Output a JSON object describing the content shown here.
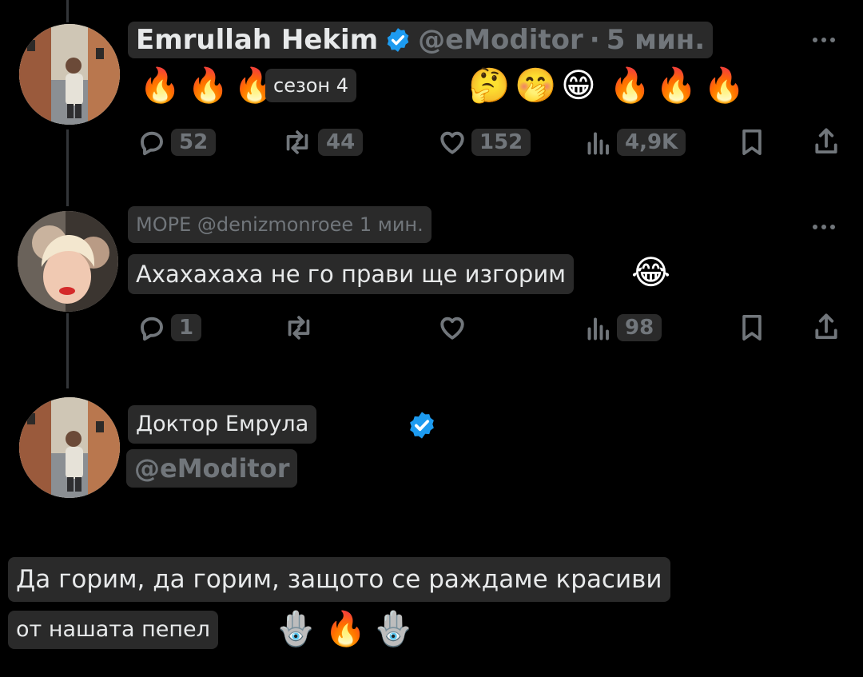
{
  "post": {
    "display_name": "Emrullah Hekim",
    "handle": "@eModitor",
    "separator": "·",
    "time": "5 мин.",
    "body_label": "сезон 4",
    "emoji_left": [
      "🔥",
      "🔥",
      "🔥"
    ],
    "emoji_right": [
      "🤔",
      "🤭",
      "😁",
      "🔥",
      "🔥",
      "🔥"
    ],
    "stats": {
      "replies": "52",
      "reposts": "44",
      "likes": "152",
      "views": "4,9K"
    }
  },
  "reply": {
    "display_name": "МОРЕ",
    "handle": "@denizmonroee",
    "time": "1 мин.",
    "text": "Ахахахаха не го прави ще изгорим",
    "emoji": "😂",
    "stats": {
      "replies": "1",
      "views": "98"
    }
  },
  "profile": {
    "display_name": "Доктор Емрула",
    "handle": "@eModitor"
  },
  "caption": {
    "line1": "Да горим, да горим, защото се раждаме красиви",
    "line2": "от нашата пепел",
    "emoji": [
      "🪬",
      "🔥",
      "🪬"
    ]
  },
  "colors": {
    "background": "#000000",
    "chip": "#2a2a2a",
    "muted": "#71767b",
    "verified": "#1d9bf0"
  },
  "icons": [
    "verified-badge-icon",
    "reply-icon",
    "repost-icon",
    "like-icon",
    "views-icon",
    "bookmark-icon",
    "share-icon",
    "more-icon"
  ]
}
